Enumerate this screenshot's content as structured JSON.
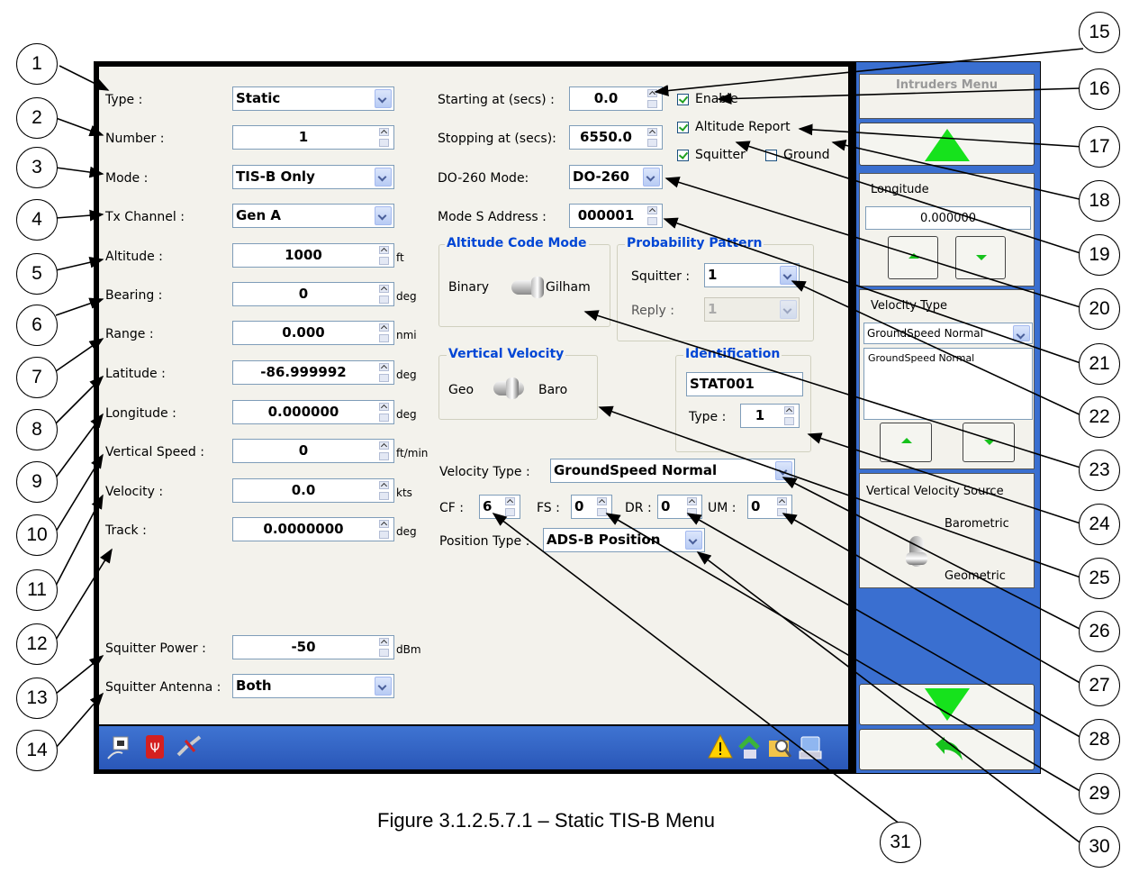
{
  "form": {
    "type": {
      "label": "Type :",
      "value": "Static"
    },
    "number": {
      "label": "Number :",
      "value": "1"
    },
    "mode": {
      "label": "Mode :",
      "value": "TIS-B Only"
    },
    "tx_channel": {
      "label": "Tx Channel :",
      "value": "Gen A"
    },
    "altitude": {
      "label": "Altitude :",
      "value": "1000",
      "unit": "ft"
    },
    "bearing": {
      "label": "Bearing :",
      "value": "0",
      "unit": "deg"
    },
    "range": {
      "label": "Range :",
      "value": "0.000",
      "unit": "nmi"
    },
    "latitude": {
      "label": "Latitude :",
      "value": "-86.999992",
      "unit": "deg"
    },
    "longitude": {
      "label": "Longitude :",
      "value": "0.000000",
      "unit": "deg"
    },
    "vertical_speed": {
      "label": "Vertical Speed :",
      "value": "0",
      "unit": "ft/min"
    },
    "velocity": {
      "label": "Velocity :",
      "value": "0.0",
      "unit": "kts"
    },
    "track": {
      "label": "Track :",
      "value": "0.0000000",
      "unit": "deg"
    },
    "squitter_power": {
      "label": "Squitter Power :",
      "value": "-50",
      "unit": "dBm"
    },
    "squitter_antenna": {
      "label": "Squitter Antenna :",
      "value": "Both"
    }
  },
  "timing": {
    "starting": {
      "label": "Starting at (secs) :",
      "value": "0.0"
    },
    "stopping": {
      "label": "Stopping at (secs):",
      "value": "6550.0"
    },
    "do260": {
      "label": "DO-260 Mode:",
      "value": "DO-260"
    },
    "mode_s": {
      "label": "Mode S Address :",
      "value": "000001"
    }
  },
  "checks": {
    "enable": {
      "label": "Enable",
      "checked": true
    },
    "altitude_report": {
      "label": "Altitude Report",
      "checked": true
    },
    "squitter": {
      "label": "Squitter",
      "checked": true
    },
    "ground": {
      "label": "Ground",
      "checked": false
    }
  },
  "altitude_code_mode": {
    "title": "Altitude Code Mode",
    "left": "Binary",
    "right": "Gilham"
  },
  "probability_pattern": {
    "title": "Probability Pattern",
    "squitter_label": "Squitter :",
    "squitter_value": "1",
    "reply_label": "Reply :",
    "reply_value": "1"
  },
  "vertical_velocity": {
    "title": "Vertical Velocity",
    "left": "Geo",
    "right": "Baro"
  },
  "identification": {
    "title": "Identification",
    "value": "STAT001",
    "type_label": "Type :",
    "type_value": "1"
  },
  "velocity_type": {
    "label": "Velocity Type :",
    "value": "GroundSpeed Normal"
  },
  "codes": {
    "cf_label": "CF :",
    "cf": "6",
    "fs_label": "FS :",
    "fs": "0",
    "dr_label": "DR :",
    "dr": "0",
    "um_label": "UM :",
    "um": "0"
  },
  "position_type": {
    "label": "Position Type :",
    "value": "ADS-B Position"
  },
  "side": {
    "title": "Intruders Menu",
    "longitude_label": "Longitude",
    "longitude_value": "0.000000",
    "velocity_type_label": "Velocity Type",
    "velocity_type_value": "GroundSpeed Normal",
    "velocity_list_item": "GroundSpeed Normal",
    "vvs_label": "Vertical Velocity Source",
    "vvs_top": "Barometric",
    "vvs_bottom": "Geometric"
  },
  "callouts": [
    "1",
    "2",
    "3",
    "4",
    "5",
    "6",
    "7",
    "8",
    "9",
    "10",
    "11",
    "12",
    "13",
    "14",
    "15",
    "16",
    "17",
    "18",
    "19",
    "20",
    "21",
    "22",
    "23",
    "24",
    "25",
    "26",
    "27",
    "28",
    "29",
    "30",
    "31"
  ],
  "caption": "Figure 3.1.2.5.7.1 – Static TIS-B Menu",
  "colors": {
    "accent": "#0046d5",
    "taskbar": "#2f62c4",
    "arrow": "#16e21c"
  }
}
